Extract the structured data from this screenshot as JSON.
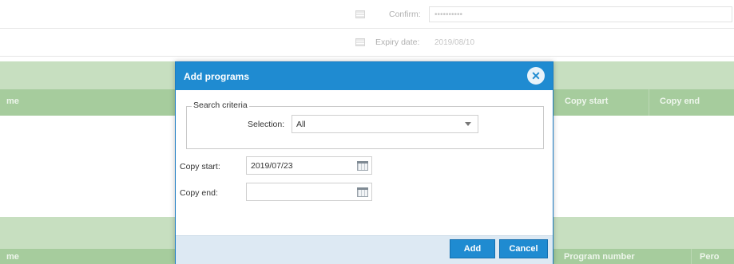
{
  "background": {
    "confirm_label": "Confirm:",
    "confirm_value": "••••••••••",
    "expiry_label": "Expiry date:",
    "expiry_value": "2019/08/10",
    "table1": {
      "col_name_fragment": "me",
      "col_copy_start": "Copy start",
      "col_copy_end": "Copy end"
    },
    "table2": {
      "col_name_fragment": "me",
      "col_program_number": "Program number",
      "col_fragment": "Pero"
    }
  },
  "dialog": {
    "title": "Add programs",
    "close_icon": "close-x-circle",
    "search_criteria_legend": "Search criteria",
    "selection_label": "Selection:",
    "selection_value": "All",
    "copy_start_label": "Copy start:",
    "copy_start_value": "2019/07/23",
    "copy_end_label": "Copy end:",
    "copy_end_value": "",
    "add_label": "Add",
    "cancel_label": "Cancel"
  },
  "colors": {
    "dialog_accent": "#1f8bd1",
    "table_band": "#c7dfc0",
    "table_header": "#a6cc9d",
    "footer": "#dde9f3"
  }
}
